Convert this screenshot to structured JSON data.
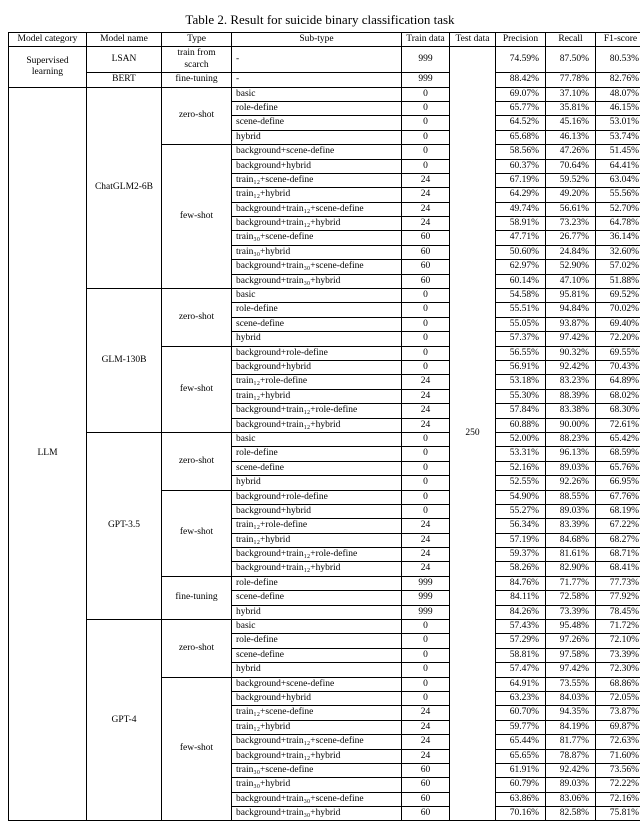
{
  "caption": "Table 2. Result for suicide binary classification task",
  "headers": {
    "c1": "Model category",
    "c2": "Model name",
    "c3": "Type",
    "c4": "Sub-type",
    "c5": "Train data",
    "c6": "Test data",
    "c7": "Precision",
    "c8": "Recall",
    "c9": "F1-score"
  },
  "sup_cat": "Supervised learning",
  "llm_cat": "LLM",
  "lsan": "LSAN",
  "bert": "BERT",
  "chatglm": "ChatGLM2-6B",
  "glm": "GLM-130B",
  "gpt35": "GPT-3.5",
  "gpt4": "GPT-4",
  "ty_scratch": "train from scarch",
  "ty_finetune": "fine-tuning",
  "ty_zero": "zero-shot",
  "ty_few": "few-shot",
  "test": "250",
  "rows": {
    "r0": {
      "sub": "-",
      "tr": "999",
      "p": "74.59%",
      "r": "87.50%",
      "f": "80.53%"
    },
    "r1": {
      "sub": "-",
      "tr": "999",
      "p": "88.42%",
      "r": "77.78%",
      "f": "82.76%"
    },
    "r2": {
      "sub": "basic",
      "tr": "0",
      "p": "69.07%",
      "r": "37.10%",
      "f": "48.07%"
    },
    "r3": {
      "sub": "role-define",
      "tr": "0",
      "p": "65.77%",
      "r": "35.81%",
      "f": "46.15%"
    },
    "r4": {
      "sub": "scene-define",
      "tr": "0",
      "p": "64.52%",
      "r": "45.16%",
      "f": "53.01%"
    },
    "r5": {
      "sub": "hybrid",
      "tr": "0",
      "p": "65.68%",
      "r": "46.13%",
      "f": "53.74%"
    },
    "r6": {
      "sub": "background+scene-define",
      "tr": "0",
      "p": "58.56%",
      "r": "47.26%",
      "f": "51.45%"
    },
    "r7": {
      "sub": "background+hybrid",
      "tr": "0",
      "p": "60.37%",
      "r": "70.64%",
      "f": "64.41%"
    },
    "r8": {
      "sub": "train₁₂+scene-define",
      "tr": "24",
      "p": "67.19%",
      "r": "59.52%",
      "f": "63.04%"
    },
    "r9": {
      "sub": "train₁₂+hybrid",
      "tr": "24",
      "p": "64.29%",
      "r": "49.20%",
      "f": "55.56%"
    },
    "r10": {
      "sub": "background+train₁₂+scene-define",
      "tr": "24",
      "p": "49.74%",
      "r": "56.61%",
      "f": "52.70%"
    },
    "r11": {
      "sub": "background+train₁₂+hybrid",
      "tr": "24",
      "p": "58.91%",
      "r": "73.23%",
      "f": "64.78%"
    },
    "r12": {
      "sub": "train₃₀+scene-define",
      "tr": "60",
      "p": "47.71%",
      "r": "26.77%",
      "f": "36.14%"
    },
    "r13": {
      "sub": "train₃₀+hybrid",
      "tr": "60",
      "p": "50.60%",
      "r": "24.84%",
      "f": "32.60%"
    },
    "r14": {
      "sub": "background+train₃₀+scene-define",
      "tr": "60",
      "p": "62.97%",
      "r": "52.90%",
      "f": "57.02%"
    },
    "r15": {
      "sub": "background+train₃₀+hybrid",
      "tr": "60",
      "p": "60.14%",
      "r": "47.10%",
      "f": "51.88%"
    },
    "r16": {
      "sub": "basic",
      "tr": "0",
      "p": "54.58%",
      "r": "95.81%",
      "f": "69.52%"
    },
    "r17": {
      "sub": "role-define",
      "tr": "0",
      "p": "55.51%",
      "r": "94.84%",
      "f": "70.02%"
    },
    "r18": {
      "sub": "scene-define",
      "tr": "0",
      "p": "55.05%",
      "r": "93.87%",
      "f": "69.40%"
    },
    "r19": {
      "sub": "hybrid",
      "tr": "0",
      "p": "57.37%",
      "r": "97.42%",
      "f": "72.20%"
    },
    "r20": {
      "sub": "background+role-define",
      "tr": "0",
      "p": "56.55%",
      "r": "90.32%",
      "f": "69.55%"
    },
    "r21": {
      "sub": "background+hybrid",
      "tr": "0",
      "p": "56.91%",
      "r": "92.42%",
      "f": "70.43%"
    },
    "r22": {
      "sub": "train₁₂+role-define",
      "tr": "24",
      "p": "53.18%",
      "r": "83.23%",
      "f": "64.89%"
    },
    "r23": {
      "sub": "train₁₂+hybrid",
      "tr": "24",
      "p": "55.30%",
      "r": "88.39%",
      "f": "68.02%"
    },
    "r24": {
      "sub": "background+train₁₂+role-define",
      "tr": "24",
      "p": "57.84%",
      "r": "83.38%",
      "f": "68.30%"
    },
    "r25": {
      "sub": "background+train₁₂+hybrid",
      "tr": "24",
      "p": "60.88%",
      "r": "90.00%",
      "f": "72.61%"
    },
    "r26": {
      "sub": "basic",
      "tr": "0",
      "p": "52.00%",
      "r": "88.23%",
      "f": "65.42%"
    },
    "r27": {
      "sub": "role-define",
      "tr": "0",
      "p": "53.31%",
      "r": "96.13%",
      "f": "68.59%"
    },
    "r28": {
      "sub": "scene-define",
      "tr": "0",
      "p": "52.16%",
      "r": "89.03%",
      "f": "65.76%"
    },
    "r29": {
      "sub": "hybrid",
      "tr": "0",
      "p": "52.55%",
      "r": "92.26%",
      "f": "66.95%"
    },
    "r30": {
      "sub": "background+role-define",
      "tr": "0",
      "p": "54.90%",
      "r": "88.55%",
      "f": "67.76%"
    },
    "r31": {
      "sub": "background+hybrid",
      "tr": "0",
      "p": "55.27%",
      "r": "89.03%",
      "f": "68.19%"
    },
    "r32": {
      "sub": "train₁₂+role-define",
      "tr": "24",
      "p": "56.34%",
      "r": "83.39%",
      "f": "67.22%"
    },
    "r33": {
      "sub": "train₁₂+hybrid",
      "tr": "24",
      "p": "57.19%",
      "r": "84.68%",
      "f": "68.27%"
    },
    "r34": {
      "sub": "background+train₁₂+role-define",
      "tr": "24",
      "p": "59.37%",
      "r": "81.61%",
      "f": "68.71%"
    },
    "r35": {
      "sub": "background+train₁₂+hybrid",
      "tr": "24",
      "p": "58.26%",
      "r": "82.90%",
      "f": "68.41%"
    },
    "r36": {
      "sub": "role-define",
      "tr": "999",
      "p": "84.76%",
      "r": "71.77%",
      "f": "77.73%"
    },
    "r37": {
      "sub": "scene-define",
      "tr": "999",
      "p": "84.11%",
      "r": "72.58%",
      "f": "77.92%"
    },
    "r38": {
      "sub": "hybrid",
      "tr": "999",
      "p": "84.26%",
      "r": "73.39%",
      "f": "78.45%"
    },
    "r39": {
      "sub": "basic",
      "tr": "0",
      "p": "57.43%",
      "r": "95.48%",
      "f": "71.72%"
    },
    "r40": {
      "sub": "role-define",
      "tr": "0",
      "p": "57.29%",
      "r": "97.26%",
      "f": "72.10%"
    },
    "r41": {
      "sub": "scene-define",
      "tr": "0",
      "p": "58.81%",
      "r": "97.58%",
      "f": "73.39%"
    },
    "r42": {
      "sub": "hybrid",
      "tr": "0",
      "p": "57.47%",
      "r": "97.42%",
      "f": "72.30%"
    },
    "r43": {
      "sub": "background+scene-define",
      "tr": "0",
      "p": "64.91%",
      "r": "73.55%",
      "f": "68.86%"
    },
    "r44": {
      "sub": "background+hybrid",
      "tr": "0",
      "p": "63.23%",
      "r": "84.03%",
      "f": "72.05%"
    },
    "r45": {
      "sub": "train₁₂+scene-define",
      "tr": "24",
      "p": "60.70%",
      "r": "94.35%",
      "f": "73.87%"
    },
    "r46": {
      "sub": "train₁₂+hybrid",
      "tr": "24",
      "p": "59.77%",
      "r": "84.19%",
      "f": "69.87%"
    },
    "r47": {
      "sub": "background+train₁₂+scene-define",
      "tr": "24",
      "p": "65.44%",
      "r": "81.77%",
      "f": "72.63%"
    },
    "r48": {
      "sub": "background+train₁₂+hybrid",
      "tr": "24",
      "p": "65.65%",
      "r": "78.87%",
      "f": "71.60%"
    },
    "r49": {
      "sub": "train₃₀+scene-define",
      "tr": "60",
      "p": "61.91%",
      "r": "92.42%",
      "f": "73.56%"
    },
    "r50": {
      "sub": "train₃₀+hybrid",
      "tr": "60",
      "p": "60.79%",
      "r": "89.03%",
      "f": "72.22%"
    },
    "r51": {
      "sub": "background+train₃₀+scene-define",
      "tr": "60",
      "p": "63.86%",
      "r": "83.06%",
      "f": "72.16%"
    },
    "r52": {
      "sub": "background+train₃₀+hybrid",
      "tr": "60",
      "p": "70.16%",
      "r": "82.58%",
      "f": "75.81%"
    }
  }
}
